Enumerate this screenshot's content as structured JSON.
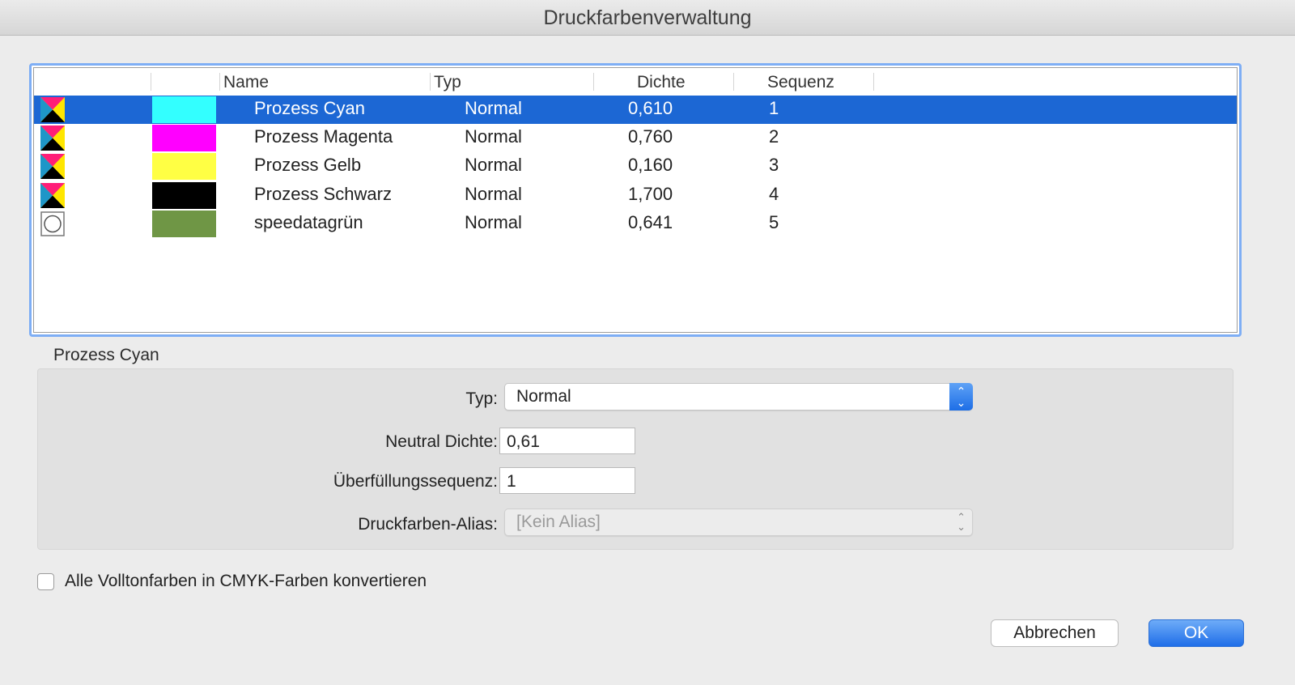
{
  "window": {
    "title": "Druckfarbenverwaltung"
  },
  "table": {
    "columns": [
      "Name",
      "Typ",
      "Dichte",
      "Sequenz"
    ],
    "rows": [
      {
        "name": "Prozess Cyan",
        "type": "Normal",
        "density": "0,610",
        "sequence": "1",
        "color": "#33ffff",
        "icon": "process-ink-icon",
        "selected": true
      },
      {
        "name": "Prozess Magenta",
        "type": "Normal",
        "density": "0,760",
        "sequence": "2",
        "color": "#ff00ff",
        "icon": "process-ink-icon",
        "selected": false
      },
      {
        "name": "Prozess Gelb",
        "type": "Normal",
        "density": "0,160",
        "sequence": "3",
        "color": "#ffff44",
        "icon": "process-ink-icon",
        "selected": false
      },
      {
        "name": "Prozess Schwarz",
        "type": "Normal",
        "density": "1,700",
        "sequence": "4",
        "color": "#000000",
        "icon": "process-ink-icon",
        "selected": false
      },
      {
        "name": "speedatagrün",
        "type": "Normal",
        "density": "0,641",
        "sequence": "5",
        "color": "#6f9645",
        "icon": "spot-ink-icon",
        "selected": false
      }
    ]
  },
  "details": {
    "title": "Prozess Cyan",
    "type_label": "Typ:",
    "type_value": "Normal",
    "density_label": "Neutral Dichte:",
    "density_value": "0,61",
    "sequence_label": "Überfüllungssequenz:",
    "sequence_value": "1",
    "alias_label": "Druckfarben-Alias:",
    "alias_value": "[Kein Alias]"
  },
  "options": {
    "convert_label": "Alle Volltonfarben in CMYK-Farben konvertieren",
    "convert_checked": false
  },
  "buttons": {
    "cancel": "Abbrechen",
    "ok": "OK"
  },
  "colors": {
    "selection": "#1c67d4",
    "accent": "#2a73e8"
  }
}
